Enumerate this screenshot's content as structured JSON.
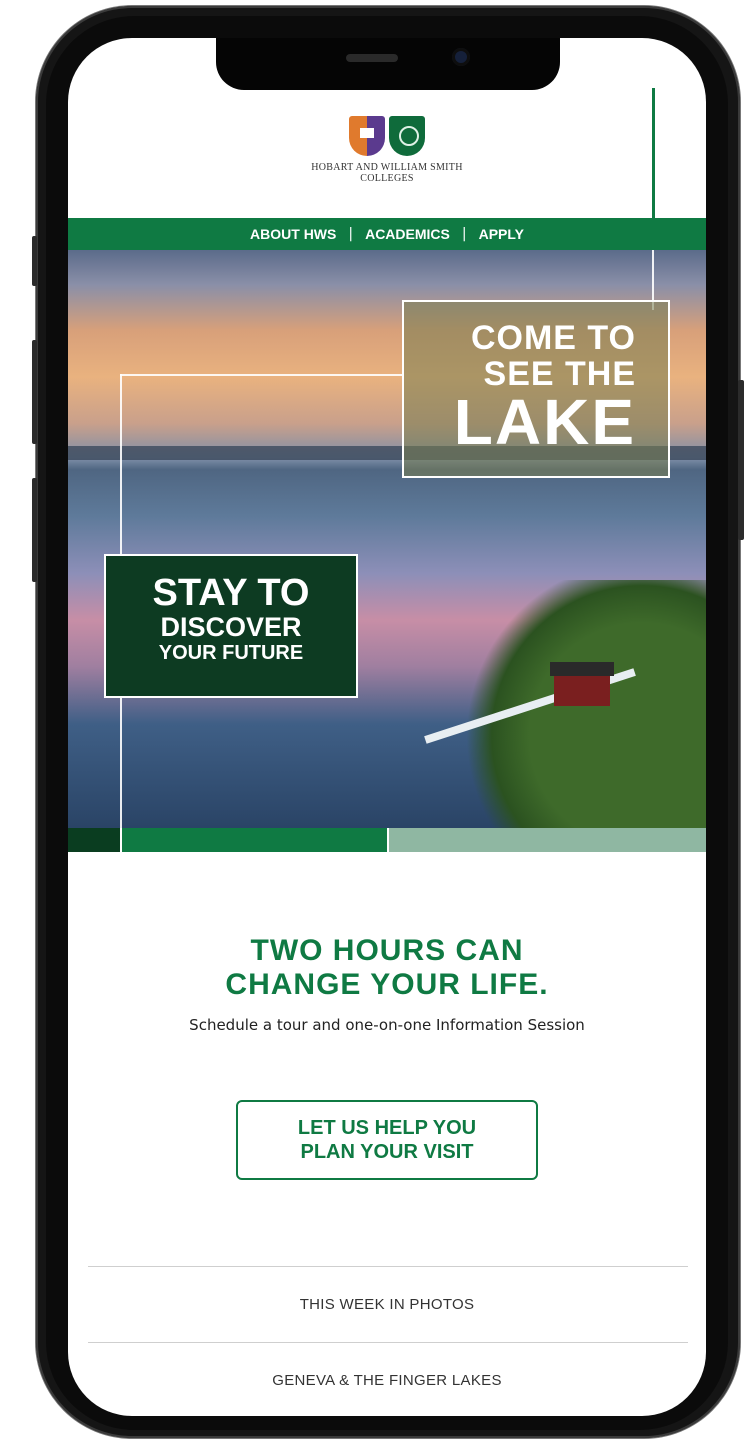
{
  "logo": {
    "line1": "HOBART AND WILLIAM SMITH",
    "line2": "COLLEGES"
  },
  "nav": {
    "items": [
      {
        "label": "ABOUT HWS"
      },
      {
        "label": "ACADEMICS"
      },
      {
        "label": "APPLY"
      }
    ],
    "separator": "|"
  },
  "hero": {
    "box1": {
      "line1": "COME TO",
      "line2": "SEE THE",
      "line3": "LAKE"
    },
    "box2": {
      "line1": "STAY TO",
      "line2": "DISCOVER",
      "line3": "YOUR FUTURE"
    }
  },
  "content": {
    "headline_line1": "TWO HOURS CAN",
    "headline_line2": "CHANGE YOUR LIFE.",
    "subheading": "Schedule a tour and one-on-one Information Session",
    "cta_line1": "LET US HELP YOU",
    "cta_line2": "PLAN YOUR VISIT"
  },
  "footer_links": [
    {
      "label": "THIS WEEK IN PHOTOS"
    },
    {
      "label": "GENEVA & THE FINGER LAKES"
    }
  ],
  "colors": {
    "brand_green": "#0f7a43",
    "dark_green": "#0a3d20",
    "light_green": "#8fb7a2"
  }
}
